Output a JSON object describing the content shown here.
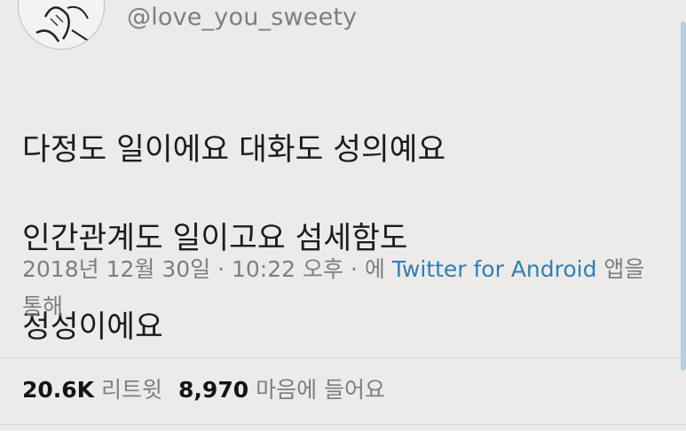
{
  "user": {
    "handle": "@love_you_sweety",
    "avatar_icon": "sketch-portrait-icon"
  },
  "tweet": {
    "text_lines": [
      "다정도 일이에요 대화도 성의예요",
      "인간관계도 일이고요 섬세함도",
      "정성이에요"
    ],
    "timestamp": "2018년 12월 30일 · 10:22 오후 · 에 ",
    "source_link": "Twitter for Android",
    "source_suffix": " 앱을 통해"
  },
  "stats": {
    "retweets_count": "20.6K",
    "retweets_label": "리트윗",
    "likes_count": "8,970",
    "likes_label": "마음에 들어요"
  },
  "colors": {
    "background": "#ecebe9",
    "link": "#2f7fb5",
    "muted": "#7a7f85"
  }
}
